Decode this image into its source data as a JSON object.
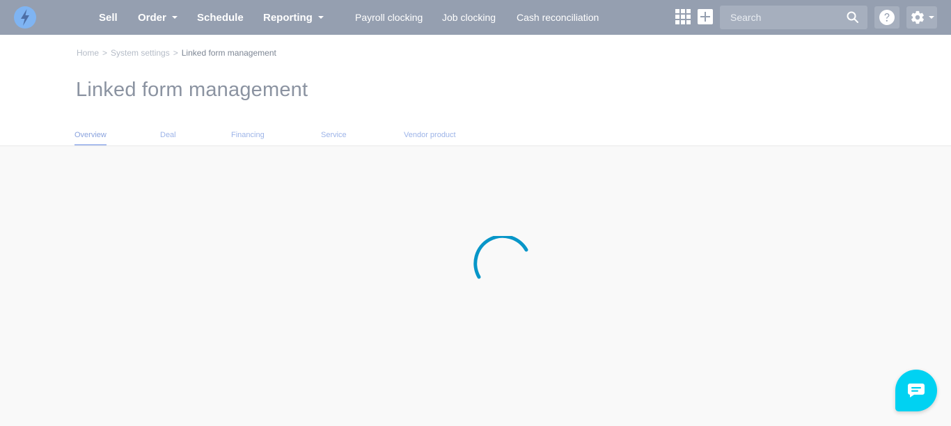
{
  "nav": {
    "sell": "Sell",
    "order": "Order",
    "schedule": "Schedule",
    "reporting": "Reporting",
    "payroll_clocking": "Payroll clocking",
    "job_clocking": "Job clocking",
    "cash_reconciliation": "Cash reconciliation"
  },
  "search": {
    "placeholder": "Search"
  },
  "breadcrumb": {
    "home": "Home",
    "separator": ">",
    "system_settings": "System settings",
    "current": "Linked form management"
  },
  "page": {
    "title": "Linked form management"
  },
  "tabs": [
    {
      "label": "Overview",
      "active": true
    },
    {
      "label": "Deal",
      "active": false
    },
    {
      "label": "Financing",
      "active": false
    },
    {
      "label": "Service",
      "active": false
    },
    {
      "label": "Vendor product",
      "active": false
    }
  ],
  "icons": {
    "logo": "lightning-bolt-icon",
    "apps": "grid-icon",
    "add": "plus-icon",
    "search": "search-icon",
    "help": "question-mark-icon",
    "settings": "gear-icon",
    "loading": "spinner-icon",
    "chat": "chat-bubble-icon"
  },
  "colors": {
    "topbar": "#959fb0",
    "accent": "#8aa3de",
    "spinner": "#0896c8",
    "chat": "#00d2f2"
  }
}
